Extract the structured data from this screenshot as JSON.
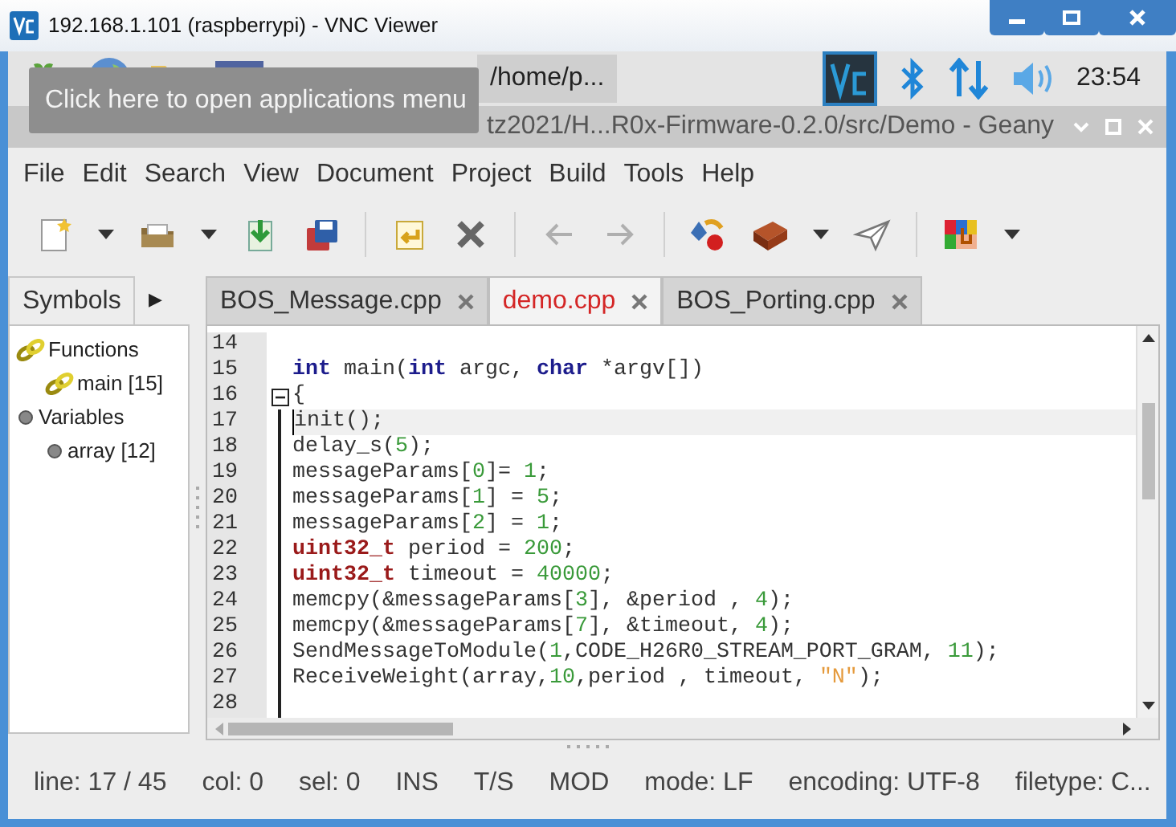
{
  "viewer_window": {
    "title": "192.168.1.101 (raspberrypi) - VNC Viewer"
  },
  "taskbar": {
    "task_button": "/home/p...",
    "clock": "23:54"
  },
  "tooltip": "Click here to open applications menu",
  "editor_window": {
    "title": "tz2021/H...R0x-Firmware-0.2.0/src/Demo - Geany"
  },
  "menu": [
    "File",
    "Edit",
    "Search",
    "View",
    "Document",
    "Project",
    "Build",
    "Tools",
    "Help"
  ],
  "toolbar": [
    {
      "kind": "button",
      "disabled": false
    },
    {
      "kind": "dropdown"
    },
    {
      "kind": "button",
      "disabled": false
    },
    {
      "kind": "dropdown"
    },
    {
      "kind": "button",
      "disabled": false
    },
    {
      "kind": "button",
      "disabled": false
    },
    {
      "kind": "separator"
    },
    {
      "kind": "button",
      "disabled": false
    },
    {
      "kind": "button",
      "disabled": false
    },
    {
      "kind": "separator"
    },
    {
      "kind": "button",
      "disabled": true
    },
    {
      "kind": "button",
      "disabled": true
    },
    {
      "kind": "separator"
    },
    {
      "kind": "button",
      "disabled": false
    },
    {
      "kind": "button",
      "disabled": false
    },
    {
      "kind": "dropdown"
    },
    {
      "kind": "button",
      "disabled": false
    },
    {
      "kind": "separator"
    },
    {
      "kind": "button",
      "disabled": false
    },
    {
      "kind": "dropdown"
    }
  ],
  "sidebar": {
    "tab": "Symbols",
    "arrow": "▶",
    "tree": [
      {
        "label": "Functions",
        "kind": "function",
        "children": [
          {
            "label": "main [15]",
            "kind": "function"
          }
        ]
      },
      {
        "label": "Variables",
        "kind": "variable",
        "children": [
          {
            "label": "array [12]",
            "kind": "variable"
          }
        ]
      }
    ]
  },
  "tabs": [
    {
      "label": "BOS_Message.cpp",
      "selected": false
    },
    {
      "label": "demo.cpp",
      "selected": true
    },
    {
      "label": "BOS_Porting.cpp",
      "selected": false
    }
  ],
  "lines": [
    {
      "number": "14",
      "current": false,
      "fold": false
    },
    {
      "number": "15",
      "current": false,
      "fold": false,
      "tokens": [
        {
          "text": "int",
          "kind": "keyword"
        },
        {
          "text": " main(",
          "kind": "plain"
        },
        {
          "text": "int",
          "kind": "keyword"
        },
        {
          "text": " argc, ",
          "kind": "plain"
        },
        {
          "text": "char",
          "kind": "keyword"
        },
        {
          "text": " *argv[])",
          "kind": "plain"
        }
      ]
    },
    {
      "number": "16",
      "current": false,
      "fold": true,
      "tokens": [
        {
          "text": "{",
          "kind": "plain"
        }
      ]
    },
    {
      "number": "17",
      "current": true,
      "fold": false,
      "tokens": [
        {
          "text": "init();",
          "kind": "plain"
        }
      ]
    },
    {
      "number": "18",
      "current": false,
      "fold": false,
      "tokens": [
        {
          "text": "delay_s(",
          "kind": "plain"
        },
        {
          "text": "5",
          "kind": "number"
        },
        {
          "text": ");",
          "kind": "plain"
        }
      ]
    },
    {
      "number": "19",
      "current": false,
      "fold": false,
      "tokens": [
        {
          "text": "messageParams[",
          "kind": "plain"
        },
        {
          "text": "0",
          "kind": "number"
        },
        {
          "text": "]= ",
          "kind": "plain"
        },
        {
          "text": "1",
          "kind": "number"
        },
        {
          "text": ";",
          "kind": "plain"
        }
      ]
    },
    {
      "number": "20",
      "current": false,
      "fold": false,
      "tokens": [
        {
          "text": "messageParams[",
          "kind": "plain"
        },
        {
          "text": "1",
          "kind": "number"
        },
        {
          "text": "] = ",
          "kind": "plain"
        },
        {
          "text": "5",
          "kind": "number"
        },
        {
          "text": ";",
          "kind": "plain"
        }
      ]
    },
    {
      "number": "21",
      "current": false,
      "fold": false,
      "tokens": [
        {
          "text": "messageParams[",
          "kind": "plain"
        },
        {
          "text": "2",
          "kind": "number"
        },
        {
          "text": "] = ",
          "kind": "plain"
        },
        {
          "text": "1",
          "kind": "number"
        },
        {
          "text": ";",
          "kind": "plain"
        }
      ]
    },
    {
      "number": "22",
      "current": false,
      "fold": false,
      "tokens": [
        {
          "text": "uint32_t",
          "kind": "type"
        },
        {
          "text": " period = ",
          "kind": "plain"
        },
        {
          "text": "200",
          "kind": "number"
        },
        {
          "text": ";",
          "kind": "plain"
        }
      ]
    },
    {
      "number": "23",
      "current": false,
      "fold": false,
      "tokens": [
        {
          "text": "uint32_t",
          "kind": "type"
        },
        {
          "text": " timeout = ",
          "kind": "plain"
        },
        {
          "text": "40000",
          "kind": "number"
        },
        {
          "text": ";",
          "kind": "plain"
        }
      ]
    },
    {
      "number": "24",
      "current": false,
      "fold": false,
      "tokens": [
        {
          "text": "memcpy(&messageParams[",
          "kind": "plain"
        },
        {
          "text": "3",
          "kind": "number"
        },
        {
          "text": "], &period , ",
          "kind": "plain"
        },
        {
          "text": "4",
          "kind": "number"
        },
        {
          "text": ");",
          "kind": "plain"
        }
      ]
    },
    {
      "number": "25",
      "current": false,
      "fold": false,
      "tokens": [
        {
          "text": "memcpy(&messageParams[",
          "kind": "plain"
        },
        {
          "text": "7",
          "kind": "number"
        },
        {
          "text": "], &timeout, ",
          "kind": "plain"
        },
        {
          "text": "4",
          "kind": "number"
        },
        {
          "text": ");",
          "kind": "plain"
        }
      ]
    },
    {
      "number": "26",
      "current": false,
      "fold": false,
      "tokens": [
        {
          "text": "SendMessageToModule(",
          "kind": "plain"
        },
        {
          "text": "1",
          "kind": "number"
        },
        {
          "text": ",CODE_H26R0_STREAM_PORT_GRAM, ",
          "kind": "plain"
        },
        {
          "text": "11",
          "kind": "number"
        },
        {
          "text": ");",
          "kind": "plain"
        }
      ]
    },
    {
      "number": "27",
      "current": false,
      "fold": false,
      "tokens": [
        {
          "text": "ReceiveWeight(array,",
          "kind": "plain"
        },
        {
          "text": "10",
          "kind": "number"
        },
        {
          "text": ",period , timeout, ",
          "kind": "plain"
        },
        {
          "text": "\"N\"",
          "kind": "string"
        },
        {
          "text": ");",
          "kind": "plain"
        }
      ]
    },
    {
      "number": "28",
      "current": false,
      "fold": false
    }
  ],
  "status_bar": [
    "line: 17 / 45",
    "col: 0",
    "sel: 0",
    "INS",
    "T/S",
    "MOD",
    "mode: LF",
    "encoding: UTF-8",
    "filetype: C..."
  ]
}
